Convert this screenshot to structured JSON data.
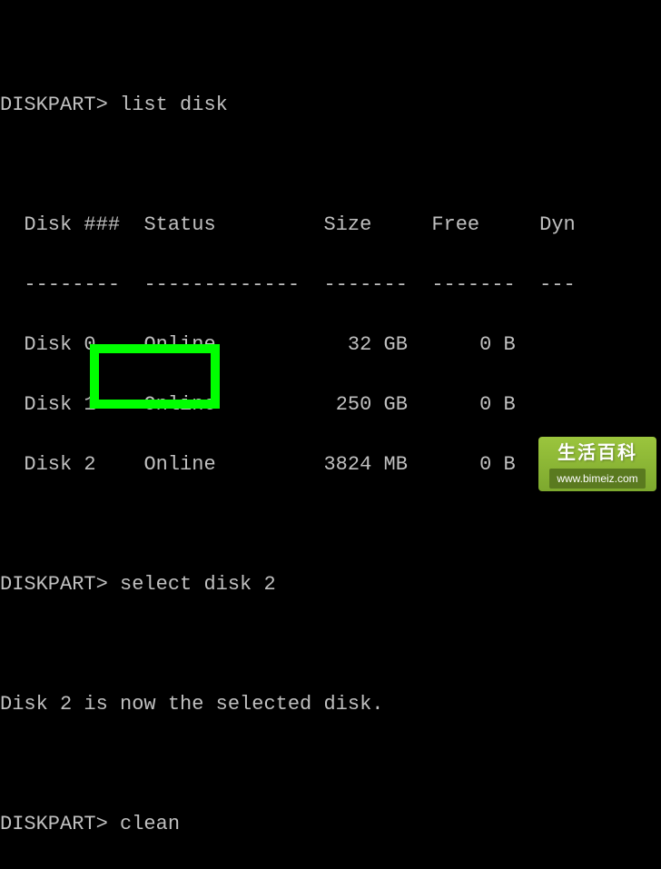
{
  "terminal": {
    "prompt": "DISKPART>",
    "commands": {
      "list_disk": "list disk",
      "select_disk": "select disk 2",
      "clean": "clean"
    },
    "table": {
      "headers": {
        "disk_num": "Disk ###",
        "status": "Status",
        "size": "Size",
        "free": "Free",
        "dyn": "Dyn"
      },
      "separators": {
        "disk_num": "--------",
        "status": "-------------",
        "size": "-------",
        "free": "-------",
        "dyn": "---"
      },
      "rows": [
        {
          "disk": "Disk 0",
          "status": "Online",
          "size": "32 GB",
          "free": "0 B"
        },
        {
          "disk": "Disk 1",
          "status": "Online",
          "size": "250 GB",
          "free": "0 B"
        },
        {
          "disk": "Disk 2",
          "status": "Online",
          "size": "3824 MB",
          "free": "0 B"
        }
      ]
    },
    "messages": {
      "selected": "Disk 2 is now the selected disk."
    }
  },
  "watermark": {
    "title": "生活百科",
    "url": "www.bimeiz.com"
  }
}
